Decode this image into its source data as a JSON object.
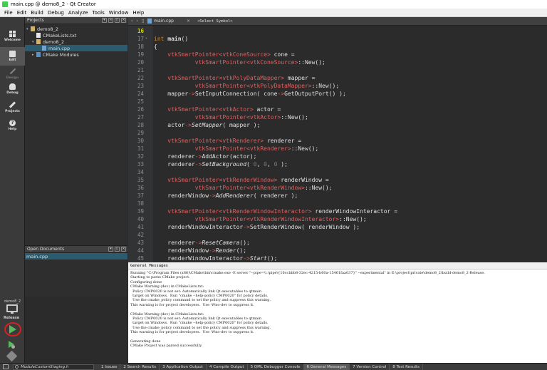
{
  "window": {
    "title": "main.cpp @ demo8_2 - Qt Creator"
  },
  "menu": [
    "File",
    "Edit",
    "Build",
    "Debug",
    "Analyze",
    "Tools",
    "Window",
    "Help"
  ],
  "modes": [
    {
      "label": "Welcome",
      "icon": "welcome-grid-icon"
    },
    {
      "label": "Edit",
      "icon": "edit-document-icon",
      "active": true
    },
    {
      "label": "Design",
      "icon": "design-pencil-icon",
      "disabled": true
    },
    {
      "label": "Debug",
      "icon": "debug-bug-icon"
    },
    {
      "label": "Projects",
      "icon": "projects-wrench-icon"
    },
    {
      "label": "Help",
      "icon": "help-question-icon"
    }
  ],
  "kit": {
    "project": "demo8_2",
    "config": "Release"
  },
  "projects_pane": {
    "title": "Projects",
    "tree": [
      {
        "label": "demo8_2",
        "depth": 0,
        "icon": "folder"
      },
      {
        "label": "CMakeLists.txt",
        "depth": 1,
        "icon": "file"
      },
      {
        "label": "demo8_2",
        "depth": 1,
        "icon": "folder"
      },
      {
        "label": "main.cpp",
        "depth": 2,
        "icon": "cpp",
        "selected": true
      },
      {
        "label": "CMake Modules",
        "depth": 1,
        "icon": "cmake"
      }
    ]
  },
  "open_docs": {
    "title": "Open Documents",
    "items": [
      "main.cpp"
    ]
  },
  "editor": {
    "filename": "main.cpp",
    "symbol": "<Select Symbol>",
    "current_line": "16",
    "lines": [
      {
        "n": "16",
        "code": ""
      },
      {
        "n": "17",
        "code": "int main()"
      },
      {
        "n": "18",
        "code": "{"
      },
      {
        "n": "19",
        "code": "    vtkSmartPointer<vtkConeSource> cone ="
      },
      {
        "n": "20",
        "code": "            vtkSmartPointer<vtkConeSource>::New();"
      },
      {
        "n": "21",
        "code": ""
      },
      {
        "n": "22",
        "code": "    vtkSmartPointer<vtkPolyDataMapper> mapper ="
      },
      {
        "n": "23",
        "code": "            vtkSmartPointer<vtkPolyDataMapper>::New();"
      },
      {
        "n": "24",
        "code": "    mapper->SetInputConnection( cone->GetOutputPort() );"
      },
      {
        "n": "25",
        "code": ""
      },
      {
        "n": "26",
        "code": "    vtkSmartPointer<vtkActor> actor ="
      },
      {
        "n": "27",
        "code": "            vtkSmartPointer<vtkActor>::New();"
      },
      {
        "n": "28",
        "code": "    actor->SetMapper( mapper );"
      },
      {
        "n": "29",
        "code": ""
      },
      {
        "n": "30",
        "code": "    vtkSmartPointer<vtkRenderer> renderer ="
      },
      {
        "n": "31",
        "code": "            vtkSmartPointer<vtkRenderer>::New();"
      },
      {
        "n": "32",
        "code": "    renderer->AddActor(actor);"
      },
      {
        "n": "33",
        "code": "    renderer->SetBackground( 0, 0, 0 );"
      },
      {
        "n": "34",
        "code": ""
      },
      {
        "n": "35",
        "code": "    vtkSmartPointer<vtkRenderWindow> renderWindow ="
      },
      {
        "n": "36",
        "code": "            vtkSmartPointer<vtkRenderWindow>::New();"
      },
      {
        "n": "37",
        "code": "    renderWindow->AddRenderer( renderer );"
      },
      {
        "n": "38",
        "code": ""
      },
      {
        "n": "39",
        "code": "    vtkSmartPointer<vtkRenderWindowInteractor> renderWindowInteractor ="
      },
      {
        "n": "40",
        "code": "            vtkSmartPointer<vtkRenderWindowInteractor>::New();"
      },
      {
        "n": "41",
        "code": "    renderWindowInteractor->SetRenderWindow( renderWindow );"
      },
      {
        "n": "42",
        "code": ""
      },
      {
        "n": "43",
        "code": "    renderer->ResetCamera();"
      },
      {
        "n": "44",
        "code": "    renderWindow->Render();"
      },
      {
        "n": "45",
        "code": "    renderWindowInteractor->Start();"
      }
    ]
  },
  "output": {
    "title": "General Messages",
    "lines": [
      "Running \"C:\\Program Files (x86)\\CMake\\bin\\cmake.exe -E server \"--pipe=\\\\.\\pipe\\{16ccbbb8-32ec-4215-b60a-15461faa037}\" --experimental\" in E:\\project\\private\\demo8_2\\build-demo8_2-Release.",
      "Starting to parse CMake project.",
      "Configuring done",
      "CMake Warning (dev) in CMakeLists.txt:",
      "  Policy CMP0020 is not set: Automatically link Qt executables to qtmain",
      "  target on Windows.  Run \"cmake --help-policy CMP0020\" for policy details.",
      "  Use the cmake_policy command to set the policy and suppress this warning.",
      "This warning is for project developers.  Use -Wno-dev to suppress it.",
      "",
      "CMake Warning (dev) in CMakeLists.txt:",
      "  Policy CMP0020 is not set: Automatically link Qt executables to qtmain",
      "  target on Windows.  Run \"cmake --help-policy CMP0020\" for policy details.",
      "  Use the cmake_policy command to set the policy and suppress this warning.",
      "This warning is for project developers.  Use -Wno-dev to suppress it.",
      "",
      "Generating done",
      "CMake Project was parsed successfully."
    ]
  },
  "statusbar": {
    "locator_placeholder": "ModuleCustomStaging.h",
    "tabs": [
      {
        "label": "1 Issues"
      },
      {
        "label": "2 Search Results"
      },
      {
        "label": "3 Application Output"
      },
      {
        "label": "4 Compile Output"
      },
      {
        "label": "5 QML Debugger Console"
      },
      {
        "label": "6 General Messages",
        "active": true
      },
      {
        "label": "7 Version Control"
      },
      {
        "label": "8 Test Results"
      }
    ]
  },
  "colors": {
    "keyword": "#d68a36",
    "type": "#e06060",
    "sidebar_bg": "#3a3a3a",
    "selection": "#2a5b6f",
    "run_highlight": "#d92020"
  }
}
